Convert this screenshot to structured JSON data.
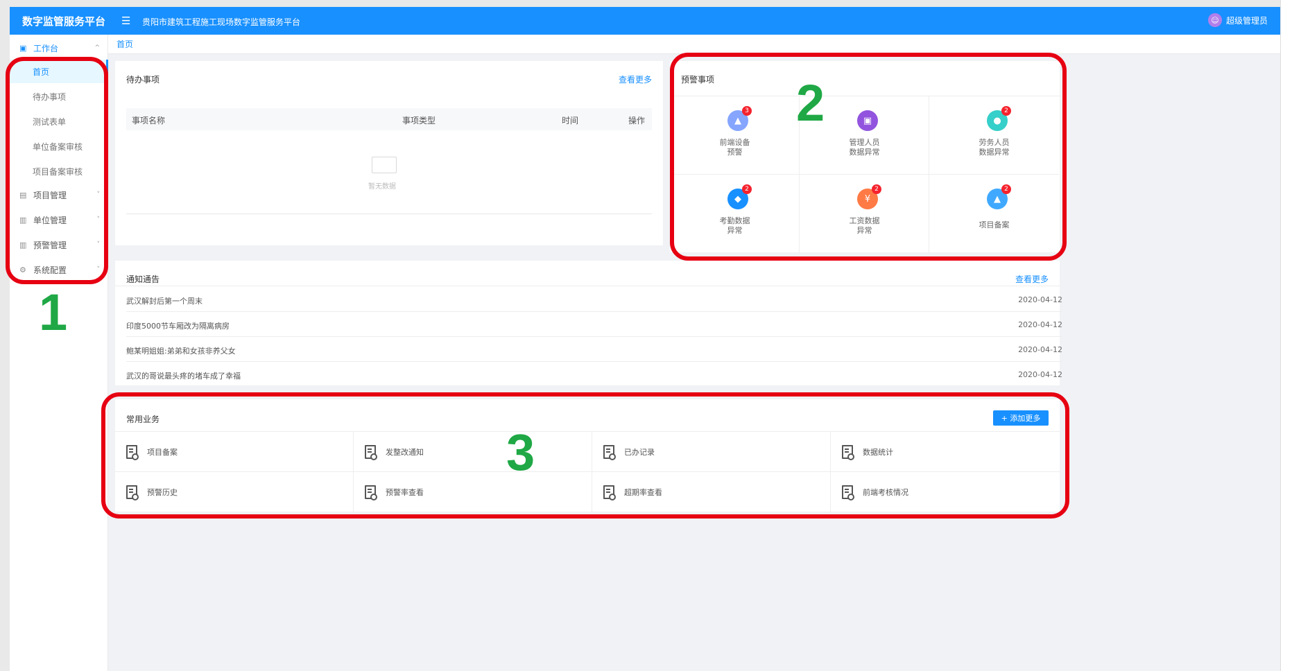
{
  "header": {
    "logo": "数字监管服务平台",
    "menu_toggle": "☰",
    "title": "贵阳市建筑工程施工现场数字监管服务平台",
    "avatar": "☺",
    "user": "超级管理员"
  },
  "sidebar": {
    "groups": [
      {
        "label": "工作台",
        "icon": "▣",
        "chevron": "^"
      },
      {
        "label": "项目管理",
        "icon": "▤",
        "chevron": "˅"
      },
      {
        "label": "单位管理",
        "icon": "▥",
        "chevron": "˅"
      },
      {
        "label": "预警管理",
        "icon": "▥",
        "chevron": "˅"
      },
      {
        "label": "系统配置",
        "icon": "⚙",
        "chevron": "˅"
      }
    ],
    "items": [
      {
        "label": "首页"
      },
      {
        "label": "待办事项"
      },
      {
        "label": "测试表单"
      },
      {
        "label": "单位备案审核"
      },
      {
        "label": "项目备案审核"
      }
    ]
  },
  "tabs": [
    {
      "label": "首页"
    }
  ],
  "todo": {
    "title": "待办事项",
    "more": "查看更多",
    "columns": [
      "事项名称",
      "事项类型",
      "时间",
      "操作"
    ],
    "empty": "暂无数据"
  },
  "warnings": {
    "title": "预警事项",
    "items": [
      {
        "line1": "前端设备",
        "line2": "预警",
        "badge": "3",
        "color": "#85a5ff",
        "icon": "▲"
      },
      {
        "line1": "管理人员",
        "line2": "数据异常",
        "badge": "",
        "color": "#9254de",
        "icon": "▣"
      },
      {
        "line1": "劳务人员",
        "line2": "数据异常",
        "badge": "2",
        "color": "#36cfc9",
        "icon": "●"
      },
      {
        "line1": "考勤数据",
        "line2": "异常",
        "badge": "2",
        "color": "#1890ff",
        "icon": "◆"
      },
      {
        "line1": "工资数据",
        "line2": "异常",
        "badge": "2",
        "color": "#ff7a45",
        "icon": "¥"
      },
      {
        "line1": "项目备案",
        "line2": "",
        "badge": "2",
        "color": "#40a9ff",
        "icon": "▲"
      }
    ]
  },
  "notices": {
    "title": "通知通告",
    "more": "查看更多",
    "rows": [
      {
        "title": "武汉解封后第一个周末",
        "date": "2020-04-12"
      },
      {
        "title": "印度5000节车厢改为隔离病房",
        "date": "2020-04-12"
      },
      {
        "title": "鲍某明姐姐:弟弟和女孩非养父女",
        "date": "2020-04-12"
      },
      {
        "title": "武汉的哥说最头疼的堵车成了幸福",
        "date": "2020-04-12"
      }
    ]
  },
  "business": {
    "title": "常用业务",
    "add_label": "+ 添加更多",
    "items": [
      {
        "label": "项目备案"
      },
      {
        "label": "发整改通知"
      },
      {
        "label": "已办记录"
      },
      {
        "label": "数据统计"
      },
      {
        "label": "预警历史"
      },
      {
        "label": "预警率查看"
      },
      {
        "label": "超期率查看"
      },
      {
        "label": "前端考核情况"
      }
    ]
  },
  "annotations": [
    "1",
    "2",
    "3"
  ]
}
